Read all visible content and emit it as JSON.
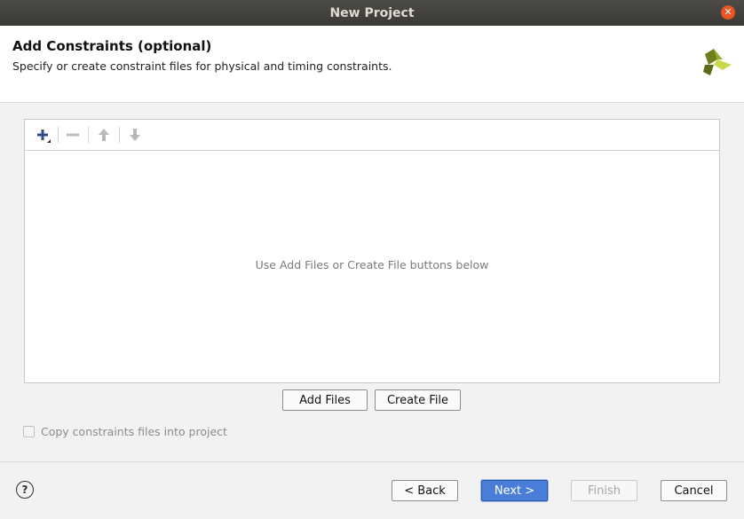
{
  "window": {
    "title": "New Project"
  },
  "header": {
    "title": "Add Constraints (optional)",
    "subtitle": "Specify or create constraint files for physical and timing constraints."
  },
  "toolbar": {
    "icons": [
      "plus-icon",
      "minus-icon",
      "arrow-up-icon",
      "arrow-down-icon"
    ]
  },
  "files_panel": {
    "empty_message": "Use Add Files or Create File buttons below"
  },
  "actions": {
    "add_files": "Add Files",
    "create_file": "Create File"
  },
  "options": {
    "copy_constraints": {
      "label": "Copy constraints files into project",
      "checked": false,
      "enabled": false
    }
  },
  "footer": {
    "back": "< Back",
    "next": "Next >",
    "finish": "Finish",
    "cancel": "Cancel",
    "help_symbol": "?"
  },
  "colors": {
    "accent": "#4a7dd8",
    "titlebar": "#3d3c38",
    "logo_dark": "#5b6b1a",
    "logo_light": "#c9d84a"
  }
}
